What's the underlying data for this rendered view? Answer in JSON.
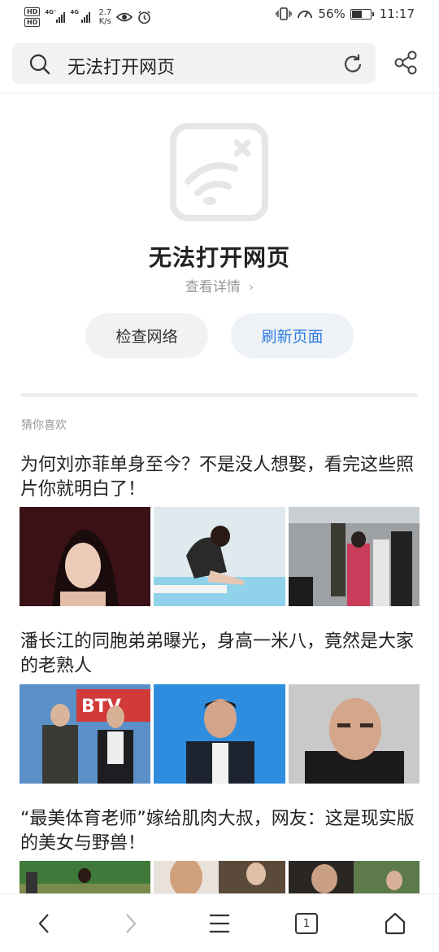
{
  "status_bar": {
    "hd1": "HD",
    "hd2": "HD",
    "net1": "4G⁺",
    "net2": "4G",
    "speed_value": "2.7",
    "speed_unit": "K/s",
    "battery_percent": "56%",
    "battery_level": 0.56,
    "time": "11:17"
  },
  "search": {
    "text": "无法打开网页"
  },
  "error": {
    "title": "无法打开网页",
    "details_label": "查看详情",
    "check_network_label": "检查网络",
    "refresh_label": "刷新页面"
  },
  "recommend": {
    "label": "猜你喜欢",
    "articles": [
      {
        "title": "为何刘亦菲单身至今？不是没人想娶，看完这些照片你就明白了！"
      },
      {
        "title": "潘长江的同胞弟弟曝光，身高一米八，竟然是大家的老熟人"
      },
      {
        "title": "“最美体育老师”嫁给肌肉大叔，网友：这是现实版的美女与野兽！"
      }
    ]
  },
  "thumb_logo_text": "BTV",
  "bottom_nav": {
    "tab_count": "1"
  },
  "colors": {
    "accent": "#2e7be0",
    "error_icon": "#e6e6e6"
  }
}
